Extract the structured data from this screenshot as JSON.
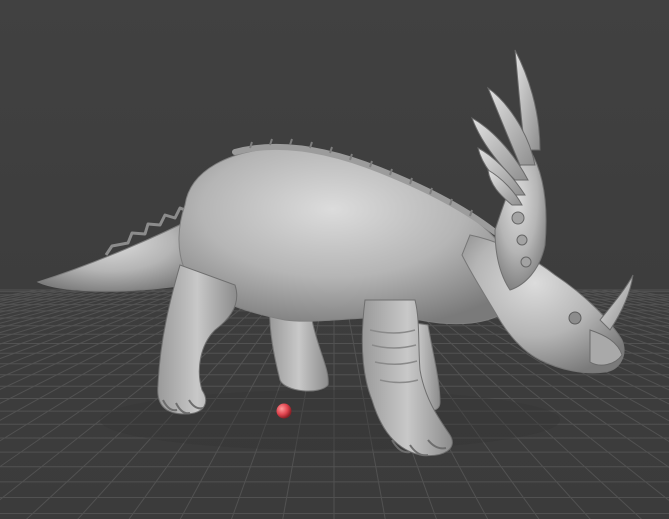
{
  "viewport": {
    "kind": "3d-model-viewport",
    "background_color": "#3f3f3f",
    "grid_color": "#555555",
    "model_color": "#b9b9b9",
    "marker_color": "#e0454f"
  },
  "model": {
    "subject": "styracosaurus-sculpt",
    "shading": "matcap-gray"
  },
  "marker": {
    "icon": "red-sphere-marker"
  }
}
